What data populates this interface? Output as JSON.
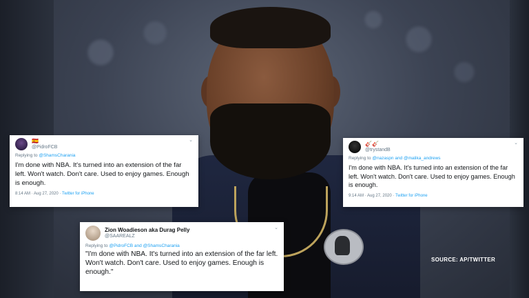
{
  "colors": {
    "link": "#1da1f2",
    "muted": "#657786",
    "card_bg": "#ffffff",
    "source_text": "#ffffff"
  },
  "tweets": [
    {
      "display_name": "🇪🇸",
      "handle": "@PidroFCB",
      "reply_prefix": "Replying to",
      "reply_to": "@ShamsCharania",
      "text": "I'm done with NBA. It's turned into an extension of the far left. Won't watch. Don't care. Used to enjoy games. Enough is enough.",
      "time": "8:14 AM · Aug 27, 2020 ·",
      "client": "Twitter for iPhone"
    },
    {
      "display_name": "🎸🎸",
      "handle": "@trystandB",
      "reply_prefix": "Replying to",
      "reply_to": "@nazaspn and @malika_andrews",
      "text": "I'm done with NBA. It's turned into an extension of the far left. Won't watch. Don't care. Used to enjoy games. Enough is enough.",
      "time": "9:14 AM · Aug 27, 2020 ·",
      "client": "Twitter for iPhone"
    },
    {
      "display_name": "Zion Woadieson aka Durag Pelly",
      "handle": "@SAAREALZ",
      "reply_prefix": "Replying to",
      "reply_to": "@PidroFCB and @ShamsCharania",
      "text": "\"I'm done with NBA. It's turned into an extension of the far left. Won't watch. Don't care. Used to enjoy games. Enough is enough.\""
    }
  ],
  "source_credit": "SOURCE: AP/TWITTER",
  "icons": {
    "chevron": "chevron-down-icon"
  }
}
